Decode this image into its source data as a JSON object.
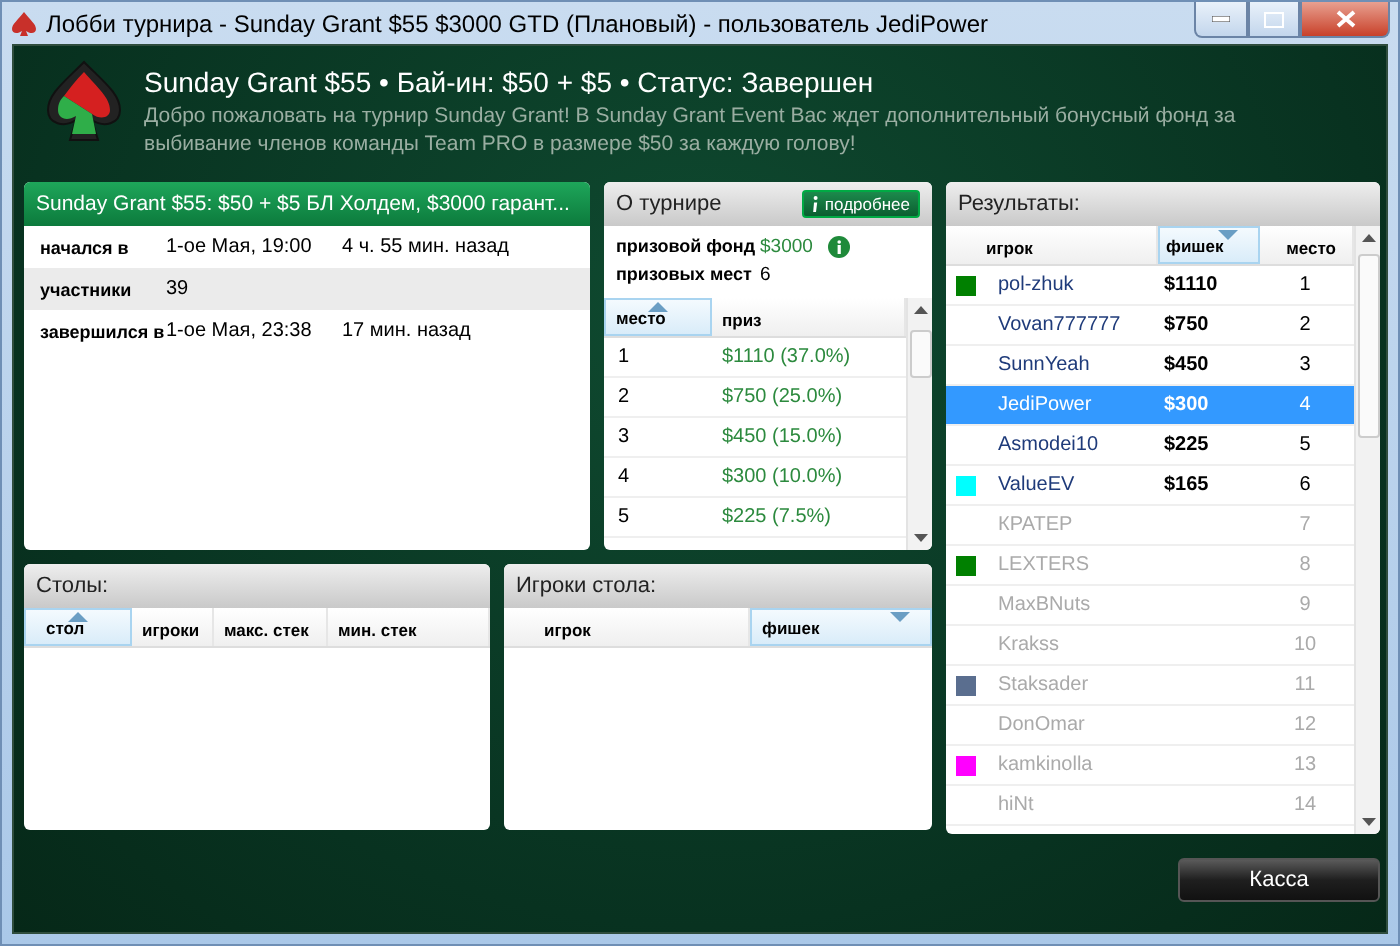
{
  "window": {
    "title": "Лобби турнира - Sunday Grant $55 $3000 GTD (Плановый) - пользователь JediPower"
  },
  "header": {
    "title": "Sunday Grant $55 • Бай-ин: $50 + $5 • Статус: Завершен",
    "description": "Добро пожаловать на турнир Sunday Grant! В Sunday Grant Event Вас ждет дополнительный бонусный фонд за выбивание членов команды Team PRO в размере $50 за каждую голову!"
  },
  "summary": {
    "title": "Sunday Grant $55: $50 + $5 БЛ Холдем, $3000 гарант...",
    "rows": [
      {
        "label": "начался в",
        "value": "1-ое Мая, 19:00",
        "ago": "4 ч. 55 мин. назад"
      },
      {
        "label": "участники",
        "value": "39"
      },
      {
        "label": "завершился в",
        "value": "1-ое Мая, 23:38",
        "ago": "17 мин. назад"
      }
    ]
  },
  "about": {
    "title": "О турнире",
    "more_button": "подробнее",
    "prize_fund_label": "призовой фонд",
    "prize_fund": "$3000",
    "paid_places_label": "призовых мест",
    "paid_places": "6",
    "columns": [
      {
        "label": "место",
        "sorted": true,
        "descending": false
      },
      {
        "label": "приз",
        "sorted": false
      }
    ],
    "rows": [
      {
        "place": "1",
        "prize": "$1110 (37.0%)"
      },
      {
        "place": "2",
        "prize": "$750 (25.0%)"
      },
      {
        "place": "3",
        "prize": "$450 (15.0%)"
      },
      {
        "place": "4",
        "prize": "$300 (10.0%)"
      },
      {
        "place": "5",
        "prize": "$225 (7.5%)"
      }
    ]
  },
  "results": {
    "title": "Результаты:",
    "columns": [
      {
        "label": "игрок",
        "sorted": false
      },
      {
        "label": "фишек",
        "sorted": true,
        "descending": true
      },
      {
        "label": "место",
        "sorted": false
      }
    ],
    "rows": [
      {
        "player": "pol-zhuk",
        "chips": "$1110",
        "place": "1",
        "color": "#008000",
        "in_money": true,
        "selected": false
      },
      {
        "player": "Vovan777777",
        "chips": "$750",
        "place": "2",
        "in_money": true,
        "selected": false
      },
      {
        "player": "SunnYeah",
        "chips": "$450",
        "place": "3",
        "in_money": true,
        "selected": false
      },
      {
        "player": "JediPower",
        "chips": "$300",
        "place": "4",
        "in_money": true,
        "selected": true
      },
      {
        "player": "Asmodei10",
        "chips": "$225",
        "place": "5",
        "in_money": true,
        "selected": false
      },
      {
        "player": "ValueEV",
        "chips": "$165",
        "place": "6",
        "color": "#00ffff",
        "in_money": true,
        "selected": false
      },
      {
        "player": "КРАТЕР",
        "place": "7",
        "in_money": false,
        "selected": false
      },
      {
        "player": "LEXTERS",
        "place": "8",
        "color": "#008000",
        "in_money": false,
        "selected": false
      },
      {
        "player": "MaxBNuts",
        "place": "9",
        "in_money": false,
        "selected": false
      },
      {
        "player": "Krakss",
        "place": "10",
        "in_money": false,
        "selected": false
      },
      {
        "player": "Staksader",
        "place": "11",
        "color": "#5a6e8f",
        "in_money": false,
        "selected": false
      },
      {
        "player": "DonOmar",
        "place": "12",
        "in_money": false,
        "selected": false
      },
      {
        "player": "kamkinolla",
        "place": "13",
        "color": "#ff00ff",
        "in_money": false,
        "selected": false
      },
      {
        "player": "hiNt",
        "place": "14",
        "in_money": false,
        "selected": false
      }
    ]
  },
  "tables": {
    "title": "Столы:",
    "columns": [
      {
        "label": "стол",
        "sorted": true,
        "descending": false
      },
      {
        "label": "игроки",
        "sorted": false
      },
      {
        "label": "макс. стек",
        "sorted": false
      },
      {
        "label": "мин. стек",
        "sorted": false
      }
    ]
  },
  "table_players": {
    "title": "Игроки стола:",
    "columns": [
      {
        "label": "игрок",
        "sorted": false
      },
      {
        "label": "фишек",
        "sorted": true,
        "descending": true
      }
    ]
  },
  "cashier_button": "Касса"
}
